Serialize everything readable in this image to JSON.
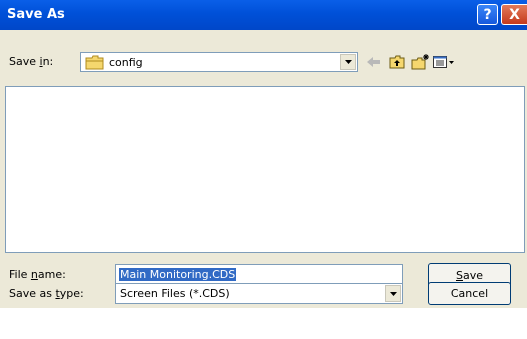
{
  "window": {
    "title": "Save As"
  },
  "titlebar": {
    "help_glyph": "?",
    "close_glyph": "X"
  },
  "save_in": {
    "label_pre": "Save ",
    "label_key": "i",
    "label_post": "n:",
    "folder": "config",
    "folder_icon": "folder-icon"
  },
  "toolbar": {
    "back_icon": "back-arrow-icon",
    "up_icon": "up-one-level-icon",
    "new_folder_icon": "new-folder-icon",
    "views_icon": "views-menu-icon"
  },
  "file_name": {
    "label_pre": "File ",
    "label_key": "n",
    "label_post": "ame:",
    "value": "Main Monitoring.CDS"
  },
  "file_type": {
    "label_pre": "Save as ",
    "label_key": "t",
    "label_post": "ype:",
    "value": "Screen Files (*.CDS)"
  },
  "buttons": {
    "save_key": "S",
    "save_rest": "ave",
    "cancel": "Cancel"
  },
  "colors": {
    "titlebar": "#0054e3",
    "dialog_bg": "#ece9d8",
    "selection": "#316ac5"
  }
}
